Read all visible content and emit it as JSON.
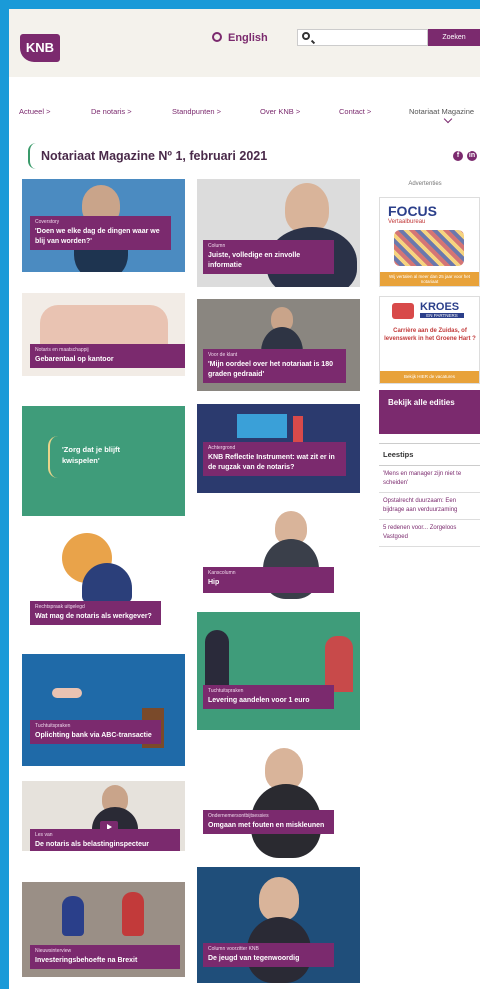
{
  "header": {
    "logo": "KNB",
    "language": "English",
    "search_placeholder": "",
    "search_button": "Zoeken"
  },
  "nav": {
    "items": [
      "Actueel >",
      "De notaris >",
      "Standpunten >",
      "Over KNB >",
      "Contact >",
      "Notariaat Magazine"
    ]
  },
  "page": {
    "title": "Notariaat Magazine Nº 1, februari 2021",
    "social": [
      "f",
      "in"
    ]
  },
  "articles": [
    {
      "cat": "Coverstory",
      "title": "'Doen we elke dag de dingen waar we blij van worden?'"
    },
    {
      "cat": "Column",
      "title": "Juiste, volledige en zinvolle informatie"
    },
    {
      "cat": "Notaris en maatschappij",
      "title": "Gebarentaal op kantoor"
    },
    {
      "cat": "Voor de klant",
      "title": "'Mijn oordeel over het notariaat is 180 graden gedraaid'"
    },
    {
      "cat": "",
      "title": "'Zorg dat je blijft kwispelen'"
    },
    {
      "cat": "Achtergrond",
      "title": "KNB Reflectie Instrument: wat zit er in de rugzak van de notaris?"
    },
    {
      "cat": "Kanscolumn",
      "title": "Hip"
    },
    {
      "cat": "Rechtspraak uitgelegd",
      "title": "Wat mag de notaris als werkgever?"
    },
    {
      "cat": "Tuchtuitspraken",
      "title": "Levering aandelen voor 1 euro"
    },
    {
      "cat": "Tuchtuitspraken",
      "title": "Oplichting bank via ABC-transactie"
    },
    {
      "cat": "Ondernemersontbijtsessies",
      "title": "Omgaan met fouten en miskleunen"
    },
    {
      "cat": "Les van",
      "title": "De notaris als belastinginspecteur"
    },
    {
      "cat": "Nieuwsinterview",
      "title": "Investeringsbehoefte na Brexit"
    },
    {
      "cat": "Column voorzitter KNB",
      "title": "De jeugd van tegenwoordig"
    }
  ],
  "sidebar": {
    "ads_heading": "Advertenties",
    "ad1": {
      "name": "FOCUS",
      "sub": "Vertaalbureau",
      "footer": "Wij vertalen al meer dan 25 jaar voor het notariaat"
    },
    "ad2": {
      "name": "KROES",
      "sub": "EN PARTNERS",
      "text": "Carrière aan de Zuidas, of levenswerk in het Groene Hart ?",
      "footer": "Bekijk HIER de vacatures"
    },
    "all_editions": "Bekijk alle edities",
    "leestips_title": "Leestips",
    "leestips": [
      "'Mens en manager zijn niet te scheiden'",
      "Opstalrecht duurzaam: Een bijdrage aan verduurzaming",
      "5 redenen voor... Zorgeloos Vastgoed"
    ]
  },
  "colors": {
    "brand": "#7b2a6e",
    "frame": "#1a9ad8",
    "green": "#3f9c7a"
  }
}
